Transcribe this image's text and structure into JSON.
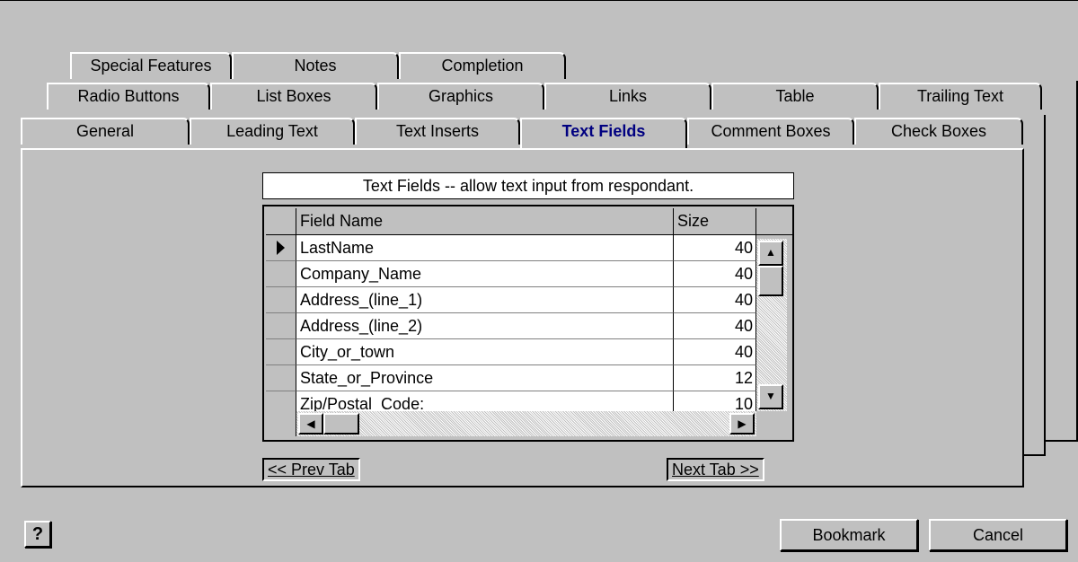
{
  "tabs": {
    "row3": [
      "Special Features",
      "Notes",
      "Completion"
    ],
    "row2": [
      "Radio Buttons",
      "List Boxes",
      "Graphics",
      "Links",
      "Table",
      "Trailing Text"
    ],
    "row1": [
      "General",
      "Leading Text",
      "Text Inserts",
      "Text Fields",
      "Comment Boxes",
      "Check Boxes"
    ],
    "active": "Text Fields"
  },
  "panel": {
    "caption": "Text Fields -- allow text input from respondant.",
    "grid": {
      "columns": [
        "Field Name",
        "Size"
      ],
      "rows": [
        {
          "name": "LastName",
          "size": "40"
        },
        {
          "name": "Company_Name",
          "size": "40"
        },
        {
          "name": "Address_(line_1)",
          "size": "40"
        },
        {
          "name": "Address_(line_2)",
          "size": "40"
        },
        {
          "name": "City_or_town",
          "size": "40"
        },
        {
          "name": "State_or_Province",
          "size": "12"
        },
        {
          "name": "Zip/Postal_Code:",
          "size": "10"
        }
      ],
      "current_row": 0
    },
    "prev_label": "<< Prev Tab",
    "next_label": "Next Tab >>"
  },
  "footer": {
    "help_icon": "question-mark-icon",
    "help_glyph": "?",
    "bookmark_label": "Bookmark",
    "cancel_label": "Cancel"
  }
}
